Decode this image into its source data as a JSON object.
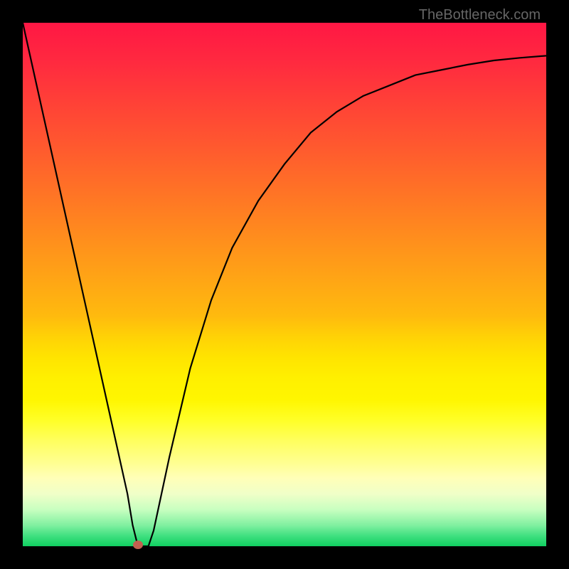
{
  "watermark": "TheBottleneck.com",
  "chart_data": {
    "type": "line",
    "title": "",
    "xlabel": "",
    "ylabel": "",
    "xlim": [
      0,
      100
    ],
    "ylim": [
      0,
      100
    ],
    "grid": false,
    "legend": false,
    "background_gradient": {
      "type": "vertical",
      "stops": [
        {
          "pos": 0.0,
          "color": "#ff1744"
        },
        {
          "pos": 0.4,
          "color": "#ff8a1e"
        },
        {
          "pos": 0.62,
          "color": "#ffe400"
        },
        {
          "pos": 0.86,
          "color": "#ffffb8"
        },
        {
          "pos": 1.0,
          "color": "#10d060"
        }
      ]
    },
    "series": [
      {
        "name": "bottleneck-curve",
        "color": "#000000",
        "x": [
          0,
          4,
          8,
          12,
          16,
          20,
          21,
          22,
          23,
          24,
          25,
          28,
          32,
          36,
          40,
          45,
          50,
          55,
          60,
          65,
          70,
          75,
          80,
          85,
          90,
          95,
          100
        ],
        "y": [
          100,
          82,
          64,
          46,
          28,
          10,
          4,
          0,
          0,
          0,
          3,
          17,
          34,
          47,
          57,
          66,
          73,
          79,
          83,
          86,
          88,
          90,
          91,
          92,
          92.8,
          93.3,
          93.7
        ]
      }
    ],
    "markers": [
      {
        "name": "optimum-point",
        "x": 22,
        "y": 0.3,
        "color": "#c26050"
      }
    ]
  }
}
